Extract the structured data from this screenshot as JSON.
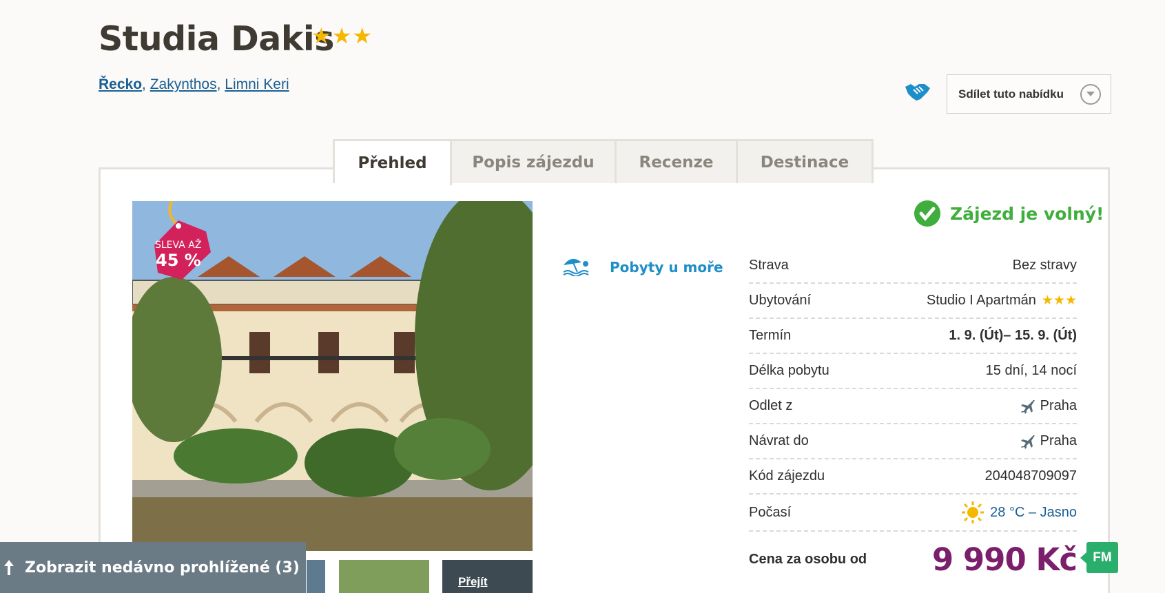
{
  "hotel": {
    "name": "Studia Dakis",
    "stars": 3
  },
  "breadcrumb": [
    "Řecko",
    "Zakynthos",
    "Limni Keri"
  ],
  "share": {
    "label": "Sdílet tuto nabídku",
    "icon": "handshake-icon"
  },
  "tabs": [
    {
      "label": "Přehled",
      "active": true
    },
    {
      "label": "Popis zájezdu",
      "active": false
    },
    {
      "label": "Recenze",
      "active": false
    },
    {
      "label": "Destinace",
      "active": false
    }
  ],
  "discount_badge": {
    "line1": "SLEVA AŽ",
    "line2": "45 %",
    "color": "#d3215b"
  },
  "thumbnail": {
    "more_label": "Přejít"
  },
  "recently_viewed": {
    "label": "Zobrazit nedávno prohlížené (3)"
  },
  "category": {
    "label": "Pobyty u moře",
    "icon": "beach-umbrella-icon"
  },
  "availability": {
    "label": "Zájezd je volný!",
    "color": "#3fae3c"
  },
  "details": [
    {
      "label": "Strava",
      "value": "Bez stravy"
    },
    {
      "label": "Ubytování",
      "value": "Studio I Apartmán"
    },
    {
      "label": "Termín",
      "value": "1. 9. (Út)– 15. 9. (Út)"
    },
    {
      "label": "Délka pobytu",
      "value": "15 dní, 14 nocí"
    },
    {
      "label": "Odlet z",
      "value": "Praha"
    },
    {
      "label": "Návrat do",
      "value": "Praha"
    },
    {
      "label": "Kód zájezdu",
      "value": "204048709097"
    },
    {
      "label": "Počasí",
      "value": "28 °C – Jasno"
    }
  ],
  "accommodation_stars": 3,
  "price": {
    "label": "Cena za osobu od",
    "value": "9 990 Kč",
    "color": "#7b1e6c"
  },
  "badge_fm": "FM"
}
